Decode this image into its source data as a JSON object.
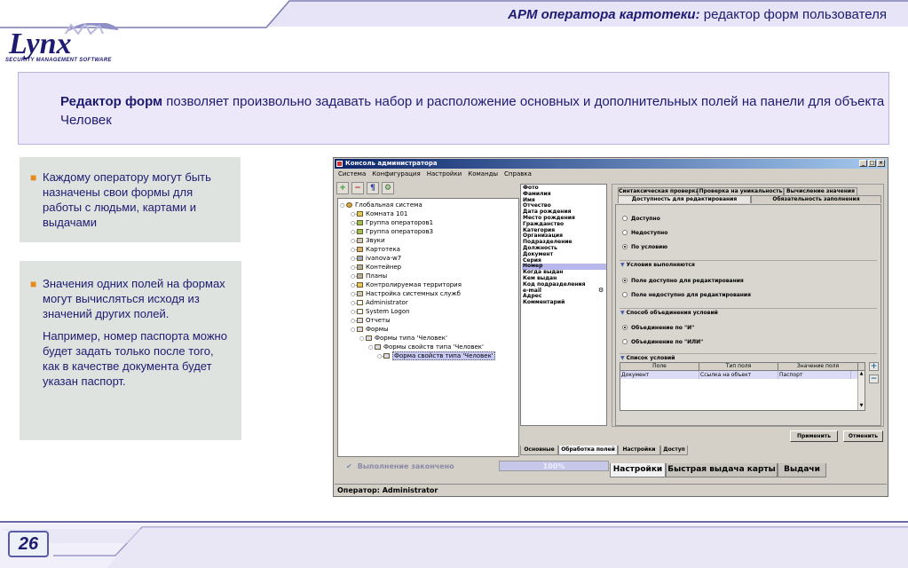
{
  "slide": {
    "title_bold": "АРМ оператора картотеки:",
    "title_rest": " редактор форм пользователя",
    "logo_text": "Lynx",
    "logo_subtitle": "SECURITY MANAGEMENT SOFTWARE",
    "intro_bold": "Редактор форм",
    "intro_rest": " позволяет произвольно задавать набор и расположение основных и дополнительных полей на панели для объекта Человек",
    "bullet1": "Каждому оператору могут быть назначены свои формы для работы с людьми, картами и выдачами",
    "bullet2": "Значения одних полей на формах могут вычисляться исходя из значений других полей.",
    "bullet2_extra": "Например, номер паспорта можно будет задать только после того, как в качестве документа будет указан паспорт.",
    "page_number": "26",
    "bullet_color": "#e58a1d",
    "accent_color": "#1d1b72"
  },
  "app": {
    "window_title": "Консоль администратора",
    "menu": [
      "Система",
      "Конфигурация",
      "Настройки",
      "Команды",
      "Справка"
    ],
    "toolbar_icons": [
      "add-icon",
      "remove-icon",
      "user-card-icon",
      "settings-icon"
    ],
    "tree": [
      {
        "label": "Глобальная система",
        "icon": "globe-icon"
      },
      {
        "label": "Комната 101",
        "icon": "room-icon"
      },
      {
        "label": "Группа операторов1",
        "icon": "group-icon"
      },
      {
        "label": "Группа операторов3",
        "icon": "group-icon"
      },
      {
        "label": "Звуки",
        "icon": "sound-icon"
      },
      {
        "label": "Картотека",
        "icon": "cardfile-icon"
      },
      {
        "label": "ivanova-w7",
        "icon": "computer-icon"
      },
      {
        "label": "Контейнер",
        "icon": "container-icon"
      },
      {
        "label": "Планы",
        "icon": "plan-icon"
      },
      {
        "label": "Контролируемая территория",
        "icon": "territory-icon"
      },
      {
        "label": "Настройка системных служб",
        "icon": "services-icon"
      },
      {
        "label": "Administrator",
        "icon": "user-icon"
      },
      {
        "label": "System Logon",
        "icon": "user-icon"
      },
      {
        "label": "Отчеты",
        "icon": "report-icon"
      },
      {
        "label": "Формы",
        "icon": "forms-icon"
      },
      {
        "label": "Формы типа 'Человек'",
        "icon": "form-icon"
      },
      {
        "label": "Формы свойств типа 'Человек'",
        "icon": "form-icon"
      },
      {
        "label": "Форма свойств типа 'Человек'",
        "icon": "form-icon"
      }
    ],
    "fields": [
      "Фото",
      "Фамилия",
      "Имя",
      "Отчество",
      "Дата рождения",
      "Место рождения",
      "Гражданство",
      "Категория",
      "Организация",
      "Подразделение",
      "Должность",
      "Документ",
      "Серия",
      "Номер",
      "Когда выдан",
      "Кем выдан",
      "Код подразделения",
      "e-mail",
      "Адрес",
      "Комментарий"
    ],
    "selected_field": "Номер",
    "prop_tabs_top": [
      "Синтаксическая проверка",
      "Проверка на уникальность",
      "Вычисление значения"
    ],
    "prop_tabs_second": [
      "Доступность для редактирования",
      "Обязательность заполнения"
    ],
    "access_options": [
      "Доступно",
      "Недоступно",
      "По условию"
    ],
    "access_selected": "По условию",
    "section_conditions_met": "Условия выполняются",
    "conditions_met_options": [
      "Поле доступно для редактирования",
      "Поле недоступно для редактирования"
    ],
    "section_combine": "Способ объединения условий",
    "combine_options": [
      "Объединение по \"И\"",
      "Объединение по \"ИЛИ\""
    ],
    "section_list": "Список условий",
    "table_headers": [
      "Поле",
      "Тип поля",
      "Значение поля"
    ],
    "table_rows": [
      [
        "Документ",
        "Ссылка на объект",
        "Паспорт"
      ]
    ],
    "apply_button": "Применить",
    "cancel_button": "Отменить",
    "bottom_tabs": [
      "Основные",
      "Обработка полей",
      "Настройки",
      "Доступ"
    ],
    "status_text": "Выполнение закончено",
    "progress_text": "100%",
    "progress": 1.0,
    "main_tabs": [
      "Настройки",
      "Быстрая выдача карты",
      "Выдачи"
    ],
    "operator_text": "Оператор: Administrator"
  }
}
